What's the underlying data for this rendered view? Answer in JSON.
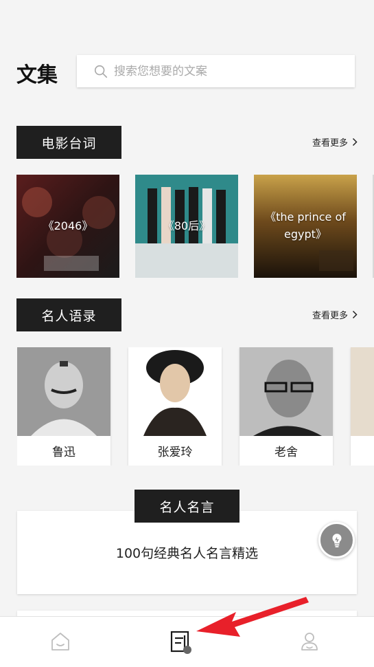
{
  "app": {
    "title": "文集"
  },
  "search": {
    "placeholder": "搜索您想要的文案",
    "icon": "search-icon"
  },
  "sections": {
    "movies": {
      "title": "电影台词",
      "more_label": "查看更多",
      "items": [
        {
          "label": "《2046》"
        },
        {
          "label": "《80后》"
        },
        {
          "label": "《the prince of egypt》"
        }
      ]
    },
    "quotes_people": {
      "title": "名人语录",
      "more_label": "查看更多",
      "items": [
        {
          "name": "鲁迅"
        },
        {
          "name": "张爱玲"
        },
        {
          "name": "老舍"
        }
      ]
    },
    "famous_sayings": {
      "title": "名人名言",
      "items": [
        {
          "text": "100句经典名人名言精选"
        }
      ]
    }
  },
  "bottom_nav": {
    "items": [
      {
        "icon": "home-icon"
      },
      {
        "icon": "document-icon",
        "active": true
      },
      {
        "icon": "profile-icon"
      }
    ]
  },
  "colors": {
    "tag_bg": "#1f1f1f",
    "page_bg": "#f4f4f4",
    "arrow": "#e8202a",
    "fab": "#8b8b8b"
  }
}
